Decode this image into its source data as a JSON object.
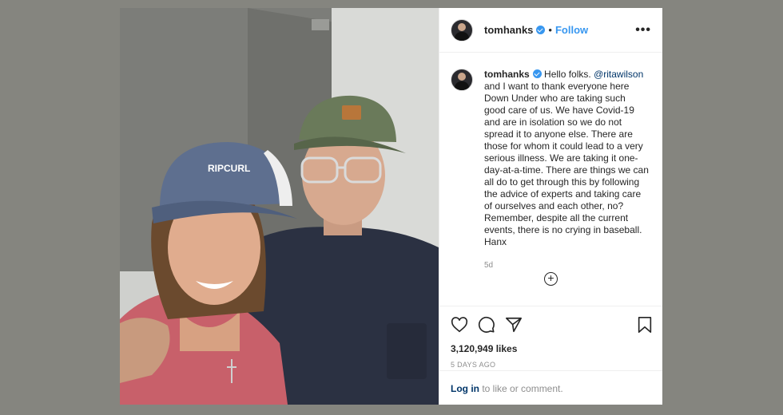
{
  "post": {
    "username": "tomhanks",
    "dot": "•",
    "follow_label": "Follow",
    "more_label": "•••",
    "caption_prefix": "Hello folks. ",
    "caption_mention": "@ritawilson",
    "caption_body": " and I want to thank everyone here Down Under who are taking such good care of us. We have Covid-19 and are in isolation so we do not spread it to anyone else. There are those for whom it could lead to a very serious illness. We are taking it one-day-at-a-time. There are things we can all do to get through this by following the advice of experts and taking care of ourselves and each other, no? Remember, despite all the current events, there is no crying in baseball. Hanx",
    "caption_age": "5d",
    "load_more": "+",
    "likes": "3,120,949 likes",
    "timestamp": "5 DAYS AGO",
    "login_link": "Log in",
    "login_rest": " to like or comment.",
    "cap_text": "RIPCURL"
  },
  "icons": [
    "heart-icon",
    "comment-icon",
    "share-icon",
    "bookmark-icon",
    "verified-icon",
    "add-circle-icon"
  ],
  "colors": {
    "link_blue": "#3897f0",
    "mention": "#003569",
    "muted": "#8e8e8e",
    "backdrop": "#85857f"
  }
}
